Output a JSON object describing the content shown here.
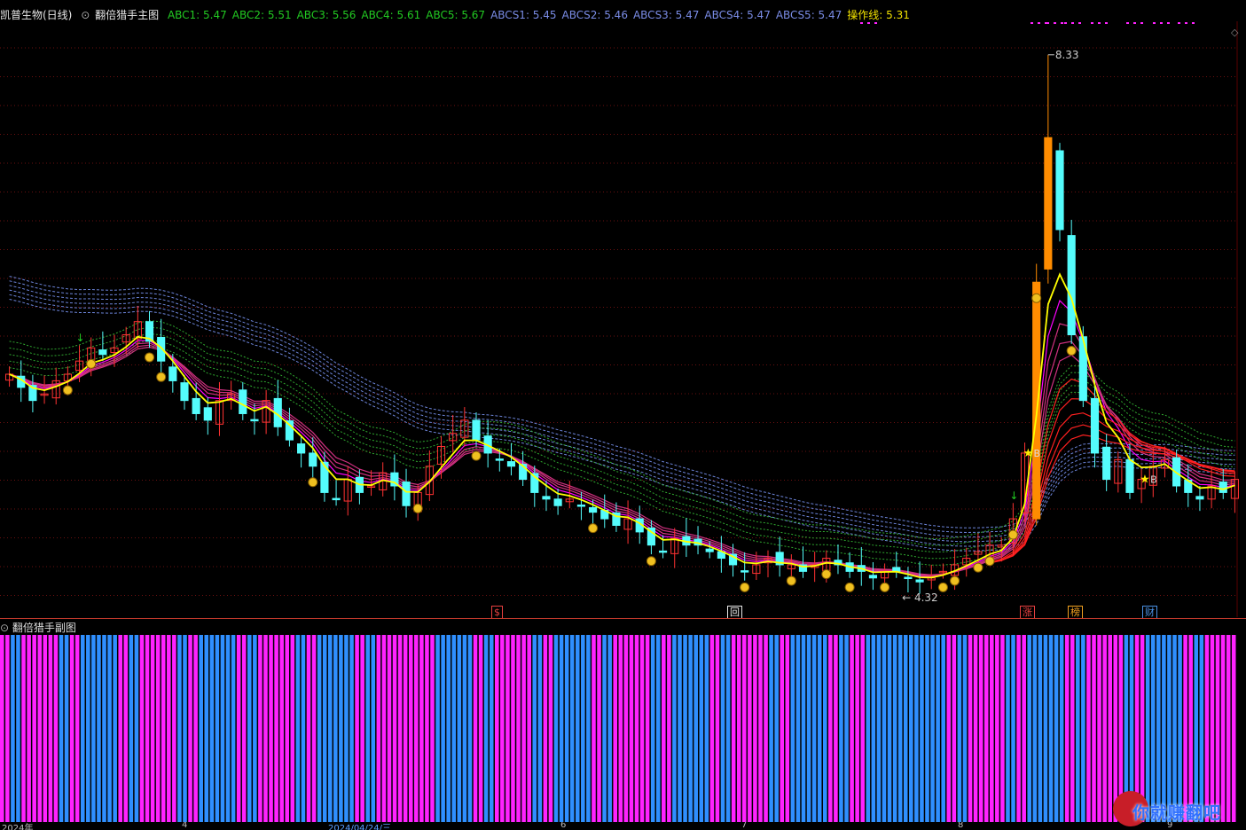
{
  "header": {
    "stock_name": "凯普生物(日线)",
    "indicator_name": "翻倍猎手主图",
    "values": [
      {
        "label": "ABC1: 5.47",
        "color": "#22c922"
      },
      {
        "label": "ABC2: 5.51",
        "color": "#22c922"
      },
      {
        "label": "ABC3: 5.56",
        "color": "#22c922"
      },
      {
        "label": "ABC4: 5.61",
        "color": "#22c922"
      },
      {
        "label": "ABC5: 5.67",
        "color": "#22c922"
      },
      {
        "label": "ABCS1: 5.45",
        "color": "#7a8ce6"
      },
      {
        "label": "ABCS2: 5.46",
        "color": "#7a8ce6"
      },
      {
        "label": "ABCS3: 5.47",
        "color": "#7a8ce6"
      },
      {
        "label": "ABCS4: 5.47",
        "color": "#7a8ce6"
      },
      {
        "label": "ABCS5: 5.47",
        "color": "#7a8ce6"
      },
      {
        "label": "操作线: 5.31",
        "color": "#f0e000"
      }
    ]
  },
  "annotations": {
    "high_label": "8.33",
    "low_label": "4.32",
    "buy_label_1": "B",
    "buy_label_2": "B"
  },
  "signals": [
    {
      "text": "$",
      "color": "#e84040"
    },
    {
      "text": "回",
      "color": "#e8e8e8"
    },
    {
      "text": "涨",
      "color": "#e84040"
    },
    {
      "text": "榜",
      "color": "#f0a020"
    },
    {
      "text": "财",
      "color": "#4a90e2"
    }
  ],
  "subchart": {
    "title": "翻倍猎手副图"
  },
  "xaxis": {
    "labels": [
      "2024年",
      "4",
      "2024/04/24/三",
      "6",
      "7",
      "8",
      "9"
    ]
  },
  "watermark": {
    "text": "你就赚翻吧"
  },
  "colors": {
    "up": "#ff3232",
    "down": "#54fcfc",
    "ma_yellow": "#ffff00",
    "ma_magenta": "#ff00ff",
    "ma_red": "#ff2020",
    "orange": "#ff8c00",
    "bar_blue": "#2f8fff",
    "bar_pink": "#ff22ff"
  },
  "chart_data": {
    "type": "candlestick",
    "y_range_visible": [
      4.32,
      8.33
    ],
    "close_approx": [
      5.9,
      5.8,
      5.7,
      5.75,
      5.85,
      5.9,
      6.0,
      6.1,
      6.05,
      6.1,
      6.2,
      6.3,
      6.15,
      6.0,
      5.85,
      5.7,
      5.6,
      5.55,
      5.7,
      5.75,
      5.6,
      5.55,
      5.7,
      5.5,
      5.4,
      5.3,
      5.2,
      5.0,
      4.95,
      5.1,
      5.0,
      5.05,
      5.15,
      5.05,
      4.9,
      5.0,
      5.2,
      5.35,
      5.45,
      5.55,
      5.4,
      5.3,
      5.25,
      5.2,
      5.1,
      5.0,
      4.95,
      4.9,
      4.95,
      4.9,
      4.85,
      4.8,
      4.75,
      4.8,
      4.7,
      4.6,
      4.55,
      4.65,
      4.6,
      4.6,
      4.55,
      4.5,
      4.45,
      4.4,
      4.45,
      4.5,
      4.45,
      4.45,
      4.4,
      4.45,
      4.5,
      4.45,
      4.4,
      4.4,
      4.35,
      4.4,
      4.4,
      4.35,
      4.32,
      4.35,
      4.4,
      4.45,
      4.5,
      4.55,
      4.6,
      4.6,
      4.8,
      5.3,
      6.6,
      7.7,
      7.0,
      6.2,
      5.7,
      5.3,
      5.1,
      5.25,
      5.0,
      5.1,
      5.2,
      5.25,
      5.05,
      5.0,
      4.95,
      5.05,
      5.0,
      5.1
    ],
    "subchart_pattern": "alternating blue/pink regime bars"
  }
}
